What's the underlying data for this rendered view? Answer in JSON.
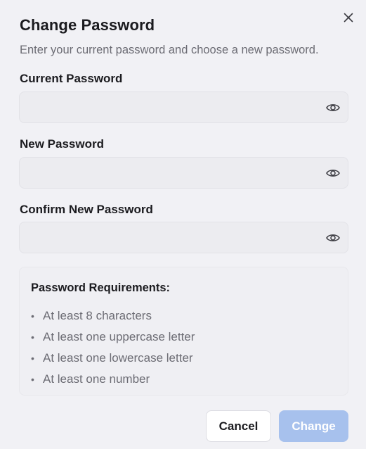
{
  "dialog": {
    "title": "Change Password",
    "subtitle": "Enter your current password and choose a new password."
  },
  "fields": [
    {
      "label": "Current Password",
      "value": "",
      "placeholder": "",
      "icon": "eye-icon"
    },
    {
      "label": "New Password",
      "value": "",
      "placeholder": "",
      "icon": "eye-icon"
    },
    {
      "label": "Confirm New Password",
      "value": "",
      "placeholder": "",
      "icon": "eye-icon"
    }
  ],
  "requirements": {
    "title": "Password Requirements:",
    "items": [
      "At least 8 characters",
      "At least one uppercase letter",
      "At least one lowercase letter",
      "At least one number"
    ]
  },
  "buttons": {
    "cancel_label": "Cancel",
    "change_label": "Change",
    "change_disabled": true
  },
  "icons": {
    "close": "close-icon",
    "toggle_visibility": "eye-icon"
  },
  "colors": {
    "background": "#f1f1f5",
    "input_background": "#ececf0",
    "primary_disabled": "#a7c1ed",
    "text": "#1b1b1f",
    "muted_text": "#6c6c74"
  }
}
